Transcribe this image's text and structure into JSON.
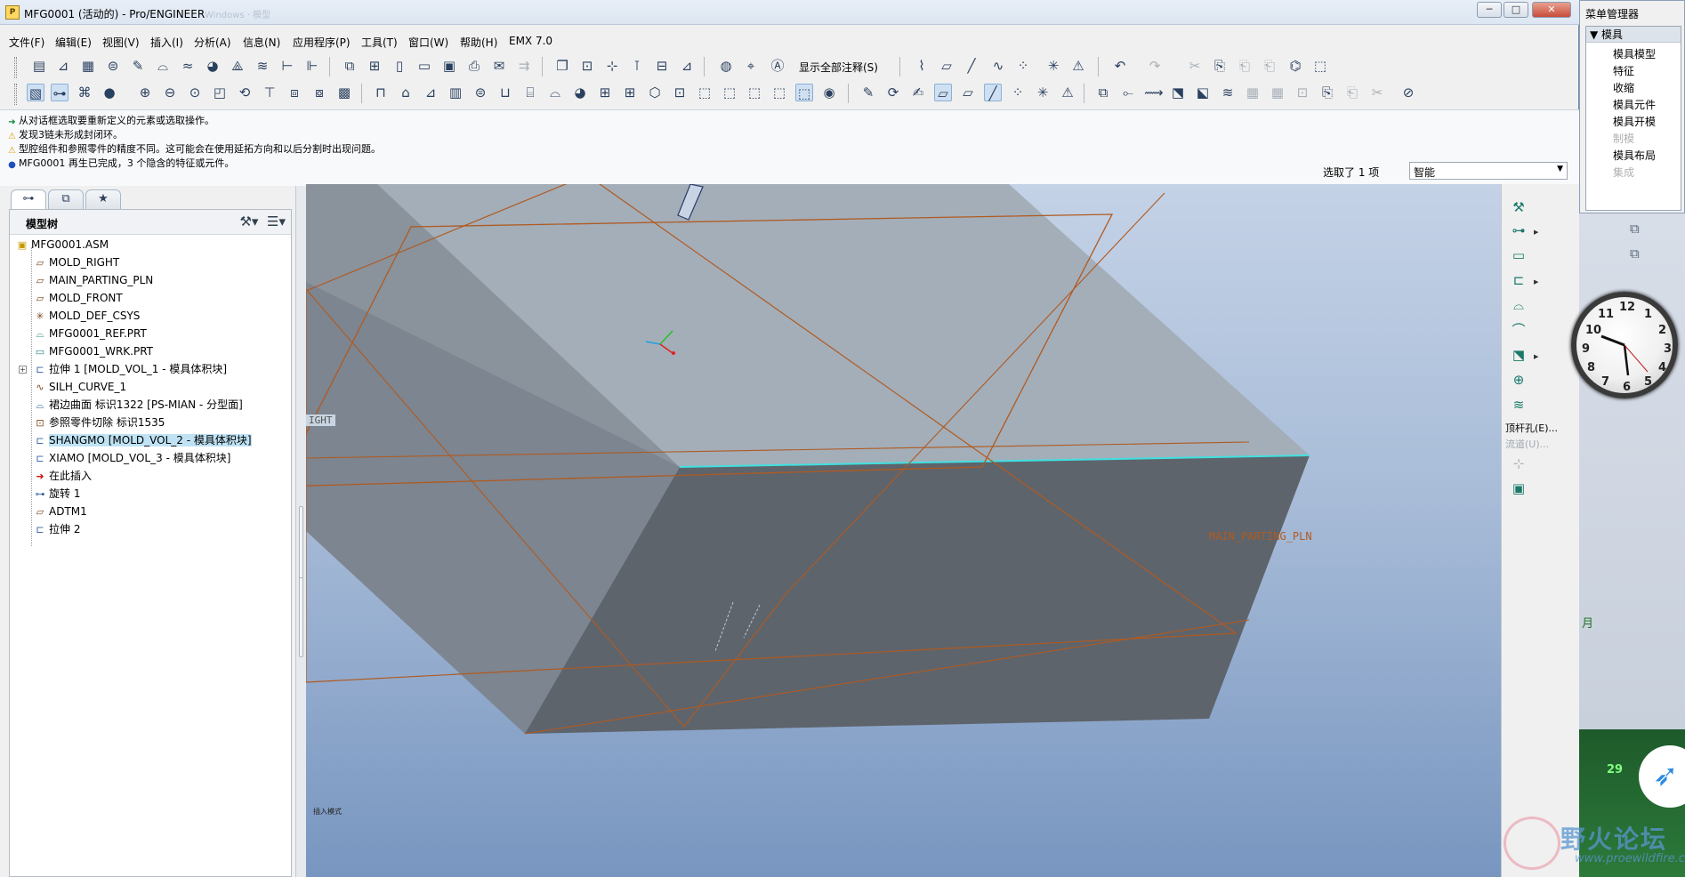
{
  "window": {
    "title": "MFG0001 (活动的) - Pro/ENGINEER",
    "ghost_title": "Windows · 模型",
    "minimize": "─",
    "maximize": "□",
    "close": "✕"
  },
  "menu": [
    "文件(F)",
    "编辑(E)",
    "视图(V)",
    "插入(I)",
    "分析(A)",
    "信息(N)",
    "应用程序(P)",
    "工具(T)",
    "窗口(W)",
    "帮助(H)",
    "EMX 7.0"
  ],
  "toolbar": {
    "show_all_notes": "显示全部注释(S)"
  },
  "messages": [
    {
      "icon": "ok",
      "text": "从对话框选取要重新定义的元素或选取操作。"
    },
    {
      "icon": "warn",
      "text": "发现3链未形成封闭环。"
    },
    {
      "icon": "warn",
      "text": "型腔组件和参照零件的精度不同。这可能会在使用延拓方向和以后分割时出现问题。"
    },
    {
      "icon": "info",
      "text": "MFG0001 再生已完成，3 个隐含的特征或元件。"
    }
  ],
  "status": {
    "selected": "选取了 1 项",
    "filter_value": "智能"
  },
  "model_tree": {
    "title": "模型树",
    "items": [
      {
        "label": "MFG0001.ASM",
        "icon": "asm"
      },
      {
        "label": "MOLD_RIGHT",
        "icon": "datum-plane"
      },
      {
        "label": "MAIN_PARTING_PLN",
        "icon": "datum-plane"
      },
      {
        "label": "MOLD_FRONT",
        "icon": "datum-plane"
      },
      {
        "label": "MOLD_DEF_CSYS",
        "icon": "csys"
      },
      {
        "label": "MFG0001_REF.PRT",
        "icon": "ref-part"
      },
      {
        "label": "MFG0001_WRK.PRT",
        "icon": "workpiece"
      },
      {
        "label": "拉伸 1 [MOLD_VOL_1 - 模具体积块]",
        "icon": "extrude"
      },
      {
        "label": "SILH_CURVE_1",
        "icon": "curve"
      },
      {
        "label": "裙边曲面 标识1322 [PS-MIAN - 分型面]",
        "icon": "surface"
      },
      {
        "label": "参照零件切除 标识1535",
        "icon": "cut"
      },
      {
        "label": "SHANGMO [MOLD_VOL_2 - 模具体积块]",
        "icon": "extrude",
        "selected": true
      },
      {
        "label": "XIAMO [MOLD_VOL_3 - 模具体积块]",
        "icon": "extrude"
      },
      {
        "label": "在此插入",
        "icon": "insert-arrow"
      },
      {
        "label": "旋转 1",
        "icon": "revolve"
      },
      {
        "label": "ADTM1",
        "icon": "datum-plane"
      },
      {
        "label": "拉伸 2",
        "icon": "extrude"
      }
    ]
  },
  "viewport": {
    "datum_label_right": "IGHT",
    "datum_label_parting": "MAIN_PARTING_PLN",
    "notice": "插入模式"
  },
  "right_toolbar": {
    "ejector_label": "顶杆孔(E)...",
    "runner_label": "流道(U)..."
  },
  "menu_manager": {
    "title": "菜单管理器",
    "header": "模具",
    "items": [
      {
        "label": "模具模型",
        "enabled": true
      },
      {
        "label": "特征",
        "enabled": true
      },
      {
        "label": "收缩",
        "enabled": true
      },
      {
        "label": "模具元件",
        "enabled": true
      },
      {
        "label": "模具开模",
        "enabled": true
      },
      {
        "label": "制模",
        "enabled": false
      },
      {
        "label": "模具布局",
        "enabled": true
      },
      {
        "label": "集成",
        "enabled": false
      }
    ]
  },
  "desktop": {
    "clock_numbers": [
      "12",
      "1",
      "2",
      "3",
      "4",
      "5",
      "6",
      "7",
      "8",
      "9",
      "10",
      "11"
    ],
    "date_text": "29",
    "moon_text": "月"
  },
  "watermark": {
    "title": "野火论坛",
    "url": "www.proewildfire.cn"
  },
  "colors": {
    "viewport_top": "#c4d2e6",
    "viewport_bottom": "#7896c0",
    "block_top": "#9ba7b3",
    "block_front": "#5a6068",
    "datum_plane": "#b05a20",
    "selection": "#bfe3f5"
  }
}
